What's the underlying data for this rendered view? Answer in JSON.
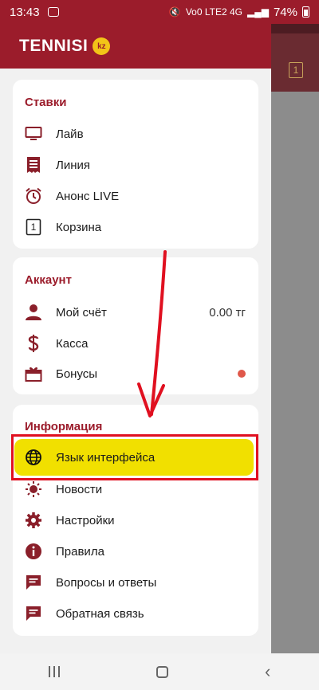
{
  "status_bar": {
    "time": "13:43",
    "network": "Vo0 LTE2 4G",
    "battery": "74%"
  },
  "app": {
    "logo_text": "TENNISI",
    "logo_badge": "kz"
  },
  "right_pane": {
    "coupon_count": "1"
  },
  "sections": {
    "bets": {
      "title": "Ставки",
      "items": [
        {
          "label": "Лайв",
          "icon": "tv-icon"
        },
        {
          "label": "Линия",
          "icon": "list-icon"
        },
        {
          "label": "Анонс LIVE",
          "icon": "alarm-icon"
        },
        {
          "label": "Корзина",
          "icon": "coupon-icon",
          "badge": "1"
        }
      ]
    },
    "account": {
      "title": "Аккаунт",
      "items": [
        {
          "label": "Мой счёт",
          "icon": "user-icon",
          "value": "0.00 тг"
        },
        {
          "label": "Касса",
          "icon": "dollar-icon"
        },
        {
          "label": "Бонусы",
          "icon": "gift-icon"
        }
      ]
    },
    "info": {
      "title": "Информация",
      "items": [
        {
          "label": "Язык интерфейса",
          "icon": "globe-icon"
        },
        {
          "label": "Новости",
          "icon": "sun-icon"
        },
        {
          "label": "Настройки",
          "icon": "gear-icon"
        },
        {
          "label": "Правила",
          "icon": "info-icon"
        },
        {
          "label": "Вопросы и ответы",
          "icon": "chat-icon"
        },
        {
          "label": "Обратная связь",
          "icon": "feedback-icon"
        }
      ]
    }
  },
  "colors": {
    "brand": "#9b1c2b",
    "highlight": "#f1e000",
    "annotation": "#e01020",
    "dot": "#e0584a"
  }
}
